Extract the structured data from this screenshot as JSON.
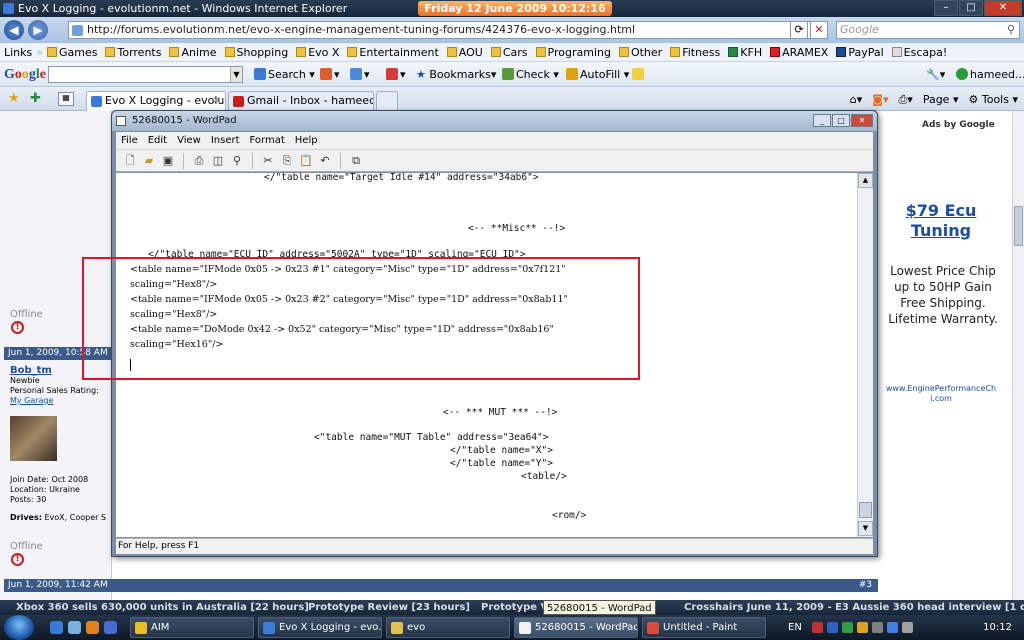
{
  "browser": {
    "title": "Evo X Logging - evolutionm.net - Windows Internet Explorer",
    "date_banner": "Friday 12 June 2009   10:12:16 PM",
    "address": "http://forums.evolutionm.net/evo-x-engine-management-tuning-forums/424376-evo-x-logging.html",
    "search_placeholder": "Google",
    "links_label": "Links",
    "links": [
      "Games",
      "Torrents",
      "Anime",
      "Shopping",
      "Evo X",
      "Entertainment",
      "AOU",
      "Cars",
      "Programing",
      "Other",
      "Fitness",
      "KFH",
      "ARAMEX",
      "PayPal",
      "Escapa!"
    ],
    "google_toolbar": {
      "logo": "Google",
      "search_label": "Search",
      "bookmarks_label": "Bookmarks",
      "check_label": "Check",
      "autofill_label": "AutoFill",
      "account_label": "hameed..."
    },
    "tabs": [
      {
        "label": "Evo X Logging - evoluti...",
        "active": true
      },
      {
        "label": "Gmail - Inbox - hameedos...",
        "active": false
      }
    ],
    "command_bar": {
      "page_label": "Page",
      "tools_label": "Tools"
    }
  },
  "forum": {
    "offline_label": "Offline",
    "post1_date": "Jun 1, 2009, 10:58 AM",
    "username": "Bob_tm",
    "user_rank": "Newbie",
    "sales_rating": "Personal Sales Rating:",
    "my_garage": "My Garage",
    "join_date": "Join Date: Oct 2008",
    "location": "Location: Ukraine",
    "posts": "Posts: 30",
    "drives_label": "Drives:",
    "drives_value": "EvoX, Cooper S",
    "post2_date": "Jun 1, 2009, 11:42 AM",
    "post2_number": "#3",
    "ads": {
      "label": "Ads by Google",
      "headline": "$79 Ecu Tuning",
      "body": "Lowest Price Chip up to 50HP Gain Free Shipping. Lifetime Warranty.",
      "url": "www.EnginePerformanceChi.com"
    }
  },
  "wordpad": {
    "title": "52680015 - WordPad",
    "menu": [
      "File",
      "Edit",
      "View",
      "Insert",
      "Format",
      "Help"
    ],
    "status": "For Help, press F1",
    "lines": [
      "</\"table name=\"Target Idle #14\" address=\"34ab6\">",
      "<--  **Misc**  --!>",
      "</\"table name=\"ECU ID\" address=\"5002A\" type=\"1D\" scaling=\"ECU ID\">",
      "<table name=\"IFMode 0x05 -> 0x23 #1\" category=\"Misc\" type=\"1D\" address=\"0x7f121\"",
      "scaling=\"Hex8\"/>",
      "<table name=\"IFMode 0x05 -> 0x23 #2\" category=\"Misc\" type=\"1D\" address=\"0x8ab11\"",
      "scaling=\"Hex8\"/>",
      "<table name=\"DoMode 0x42 -> 0x52\" category=\"Misc\" type=\"1D\" address=\"0x8ab16\"",
      "scaling=\"Hex16\"/>",
      "<--  *** MUT ***  --!>",
      "<\"table name=\"MUT Table\" address=\"3ea64\">",
      "</\"table name=\"X\">",
      "</\"table name=\"Y\">",
      "<table/>",
      "<rom/>"
    ]
  },
  "ticker": {
    "items": [
      "Xbox 360 sells 630,000 units in Australia [22 hours]",
      "Prototype Review [23 hours]",
      "Prototype Vi",
      "Crosshairs June 11, 2009 - E3 Aussie 360 head interview [1 day]"
    ],
    "tooltip": "52680015 - WordPad"
  },
  "taskbar": {
    "buttons": [
      {
        "label": "AIM",
        "active": false
      },
      {
        "label": "Evo X Logging - evo...",
        "active": false
      },
      {
        "label": "evo",
        "active": false
      },
      {
        "label": "52680015 - WordPad",
        "active": true
      },
      {
        "label": "Untitled - Paint",
        "active": false
      }
    ],
    "language": "EN",
    "clock": "10:12"
  }
}
